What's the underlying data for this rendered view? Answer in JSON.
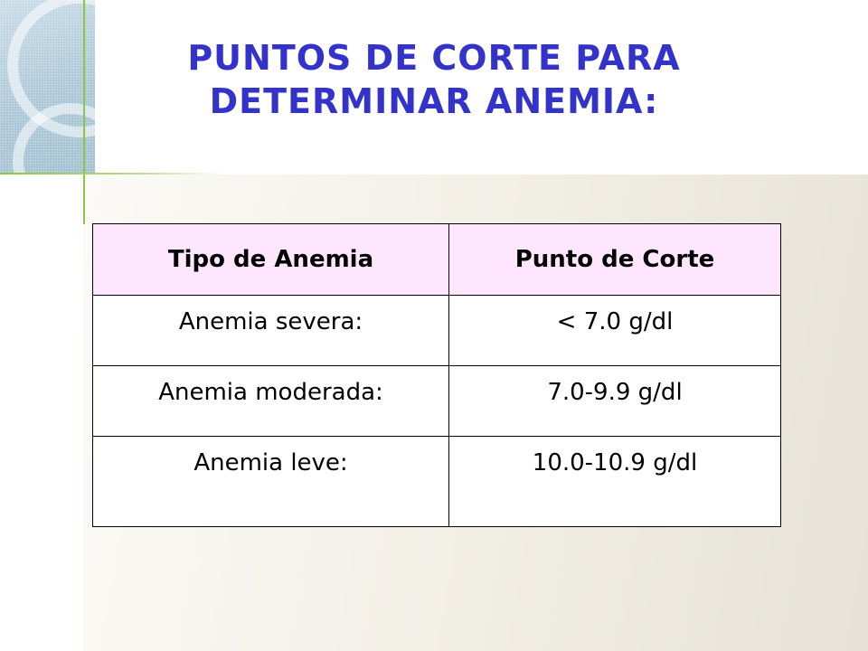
{
  "title": {
    "line1": "PUNTOS DE CORTE PARA",
    "line2": "DETERMINAR ANEMIA:"
  },
  "colors": {
    "title": "#3333cc",
    "header_bg": "#ffe6ff",
    "accent_green": "#8dc63f"
  },
  "table": {
    "headers": [
      "Tipo de Anemia",
      "Punto de Corte"
    ],
    "rows": [
      [
        "Anemia severa:",
        "< 7.0 g/dl"
      ],
      [
        "Anemia moderada:",
        "7.0-9.9 g/dl"
      ],
      [
        "Anemia leve:",
        "10.0-10.9 g/dl"
      ]
    ]
  }
}
